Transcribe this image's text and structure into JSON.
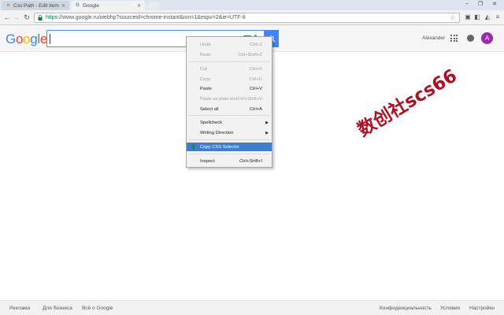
{
  "browser": {
    "tabs": [
      {
        "title": "Css Path - Edit Item",
        "favicon": "extension-favicon-icon"
      },
      {
        "title": "Google",
        "favicon": "google-favicon-icon"
      }
    ],
    "window_controls": {
      "minimize": "–",
      "restore": "❐",
      "close": "✕"
    },
    "address_bar": {
      "url_secure": "https",
      "url_rest": "://www.google.ru/webhp?sourceid=chrome-instant&ion=1&espv=2&ie=UTF-8"
    }
  },
  "google": {
    "logo_letters": [
      "G",
      "o",
      "o",
      "g",
      "l",
      "e"
    ],
    "logo_colors": [
      "#4285f4",
      "#ea4335",
      "#fbbc05",
      "#4285f4",
      "#34a853",
      "#ea4335"
    ],
    "user_name": "Alexander",
    "avatar_letter": "A",
    "avatar_color": "#9c27b0"
  },
  "context_menu": {
    "items": [
      {
        "label": "Undo",
        "shortcut": "Ctrl+Z",
        "state": "disabled"
      },
      {
        "label": "Redo",
        "shortcut": "Ctrl+Shift+Z",
        "state": "disabled"
      },
      {
        "label": "Cut",
        "shortcut": "Ctrl+X",
        "state": "disabled"
      },
      {
        "label": "Copy",
        "shortcut": "Ctrl+C",
        "state": "disabled"
      },
      {
        "label": "Paste",
        "shortcut": "Ctrl+V",
        "state": "enabled"
      },
      {
        "label": "Paste as plain text",
        "shortcut": "Ctrl+Shift+V",
        "state": "disabled"
      },
      {
        "label": "Select all",
        "shortcut": "Ctrl+A",
        "state": "enabled"
      },
      {
        "label": "Spellcheck",
        "shortcut": "",
        "state": "enabled",
        "submenu": true
      },
      {
        "label": "Writing Direction",
        "shortcut": "",
        "state": "enabled",
        "submenu": true
      },
      {
        "label": "Copy CSS Selector",
        "shortcut": "",
        "state": "highlighted",
        "icon": "tree-icon"
      },
      {
        "label": "Inspect",
        "shortcut": "Ctrl+Shift+I",
        "state": "enabled"
      }
    ],
    "highlight_color": "#3c7fd0"
  },
  "watermark": {
    "text": "数创社scs66",
    "color": "#b01025"
  },
  "footer": {
    "left": [
      "Реклама",
      "Для бизнеса",
      "Всё о Google"
    ],
    "right": [
      "Конфиденциальность",
      "Условия",
      "Настройки"
    ]
  }
}
